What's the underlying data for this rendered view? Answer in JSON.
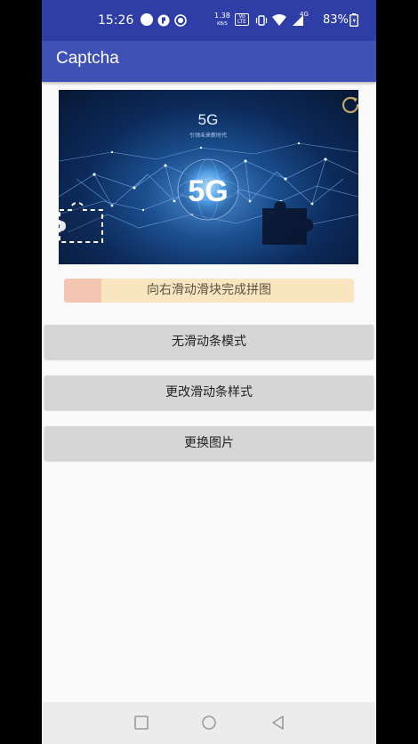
{
  "status_bar": {
    "time": "15:26",
    "network_speed_value": "1.38",
    "network_speed_unit": "KB/S",
    "volte": "Vo LTE",
    "signal": "4G",
    "battery": "83%"
  },
  "app_bar": {
    "title": "Captcha"
  },
  "captcha": {
    "image_heading": "5G",
    "image_subheading": "引领未来新时代",
    "image_center_text": "5G"
  },
  "slider": {
    "hint": "向右滑动滑块完成拼图"
  },
  "buttons": {
    "no_slider_mode": "无滑动条模式",
    "change_slider_style": "更改滑动条样式",
    "change_image": "更换图片"
  },
  "colors": {
    "status_bar": "#2f3ea6",
    "app_bar": "#3f51b5",
    "slider_track": "#f9e6c0",
    "slider_thumb": "#f2c6b3",
    "button": "#d6d6d6"
  }
}
